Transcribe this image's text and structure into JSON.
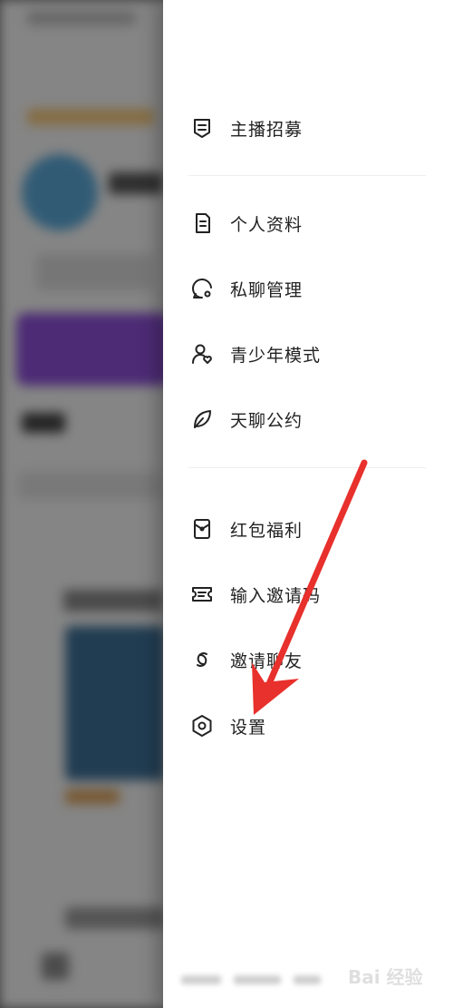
{
  "menu": {
    "group1": [
      {
        "label": "主播招募",
        "icon": "broadcaster-recruit-icon"
      }
    ],
    "group2": [
      {
        "label": "个人资料",
        "icon": "profile-doc-icon"
      },
      {
        "label": "私聊管理",
        "icon": "chat-settings-icon"
      },
      {
        "label": "青少年模式",
        "icon": "teen-mode-icon"
      },
      {
        "label": "天聊公约",
        "icon": "leaf-icon"
      }
    ],
    "group3": [
      {
        "label": "红包福利",
        "icon": "red-envelope-icon"
      },
      {
        "label": "输入邀请码",
        "icon": "ticket-icon"
      },
      {
        "label": "邀请聊友",
        "icon": "link-icon"
      },
      {
        "label": "设置",
        "icon": "settings-hexagon-icon"
      }
    ]
  },
  "annotation": {
    "arrow_color": "#e8302c"
  },
  "watermark": {
    "text": "Bai 经验"
  }
}
